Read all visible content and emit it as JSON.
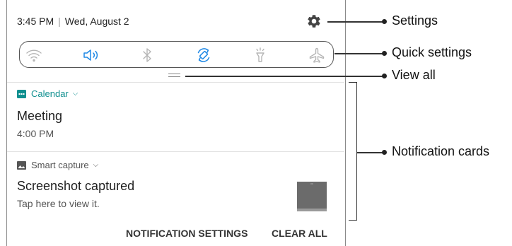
{
  "status_bar": {
    "time": "3:45 PM",
    "separator": "|",
    "date": "Wed, August 2"
  },
  "quick_settings": {
    "icons": [
      "wifi-icon",
      "sound-icon",
      "bluetooth-icon",
      "auto-rotate-icon",
      "flashlight-icon",
      "airplane-mode-icon"
    ],
    "active_color": "#1e88e5",
    "inactive_color": "#b5b5b5"
  },
  "notifications": [
    {
      "app": "Calendar",
      "icon": "calendar-icon",
      "app_color": "#0f8f8f",
      "title": "Meeting",
      "text": "4:00 PM"
    },
    {
      "app": "Smart capture",
      "icon": "image-icon",
      "app_color": "#555555",
      "title": "Screenshot captured",
      "text": "Tap here to view it."
    }
  ],
  "actions": {
    "settings": "NOTIFICATION SETTINGS",
    "clear": "CLEAR ALL"
  },
  "callouts": {
    "settings": "Settings",
    "quick_settings": "Quick settings",
    "view_all": "View all",
    "notification_cards": "Notification cards"
  }
}
